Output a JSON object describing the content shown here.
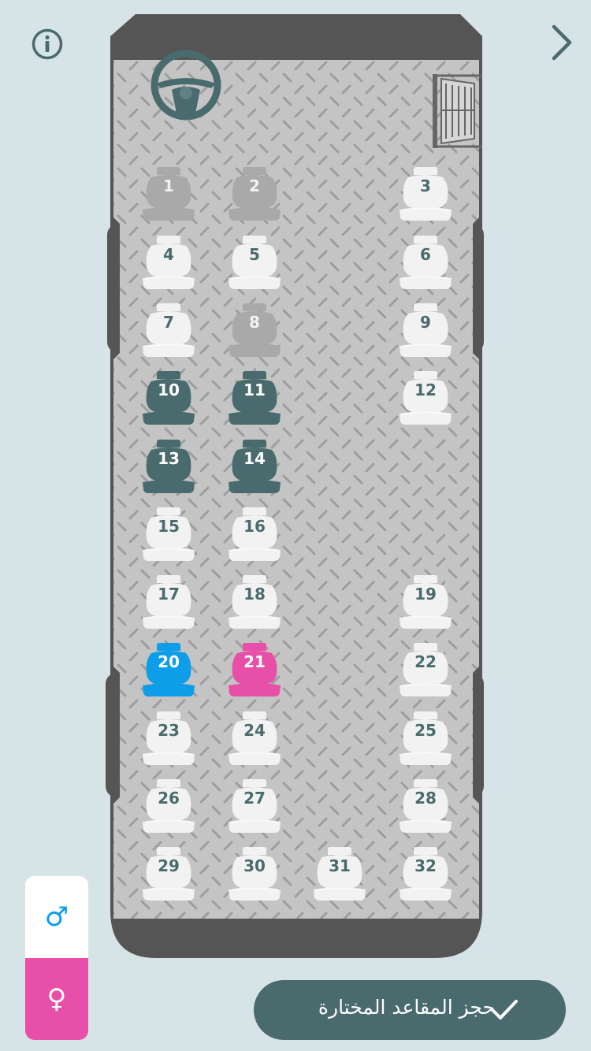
{
  "header": {
    "info_icon": "info-icon",
    "next_icon": "chevron-right-icon"
  },
  "bus": {
    "driver_icon": "steering-wheel-icon",
    "door_icon": "door-stairs-icon",
    "colors": {
      "available": "#f2f2f2",
      "unavailable": "#a9a9a9",
      "booked": "#4a6b6e",
      "male": "#0e9de8",
      "female": "#e84fa8"
    },
    "seats": [
      {
        "label": "1",
        "status": "unavailable"
      },
      {
        "label": "2",
        "status": "unavailable"
      },
      {
        "label": "3",
        "status": "available"
      },
      {
        "label": "4",
        "status": "available"
      },
      {
        "label": "5",
        "status": "available"
      },
      {
        "label": "6",
        "status": "available"
      },
      {
        "label": "7",
        "status": "available"
      },
      {
        "label": "8",
        "status": "unavailable"
      },
      {
        "label": "9",
        "status": "available"
      },
      {
        "label": "10",
        "status": "booked"
      },
      {
        "label": "11",
        "status": "booked"
      },
      {
        "label": "12",
        "status": "available"
      },
      {
        "label": "13",
        "status": "booked"
      },
      {
        "label": "14",
        "status": "booked"
      },
      {
        "label": "15",
        "status": "available"
      },
      {
        "label": "16",
        "status": "available"
      },
      {
        "label": "17",
        "status": "available"
      },
      {
        "label": "18",
        "status": "available"
      },
      {
        "label": "19",
        "status": "available"
      },
      {
        "label": "20",
        "status": "male"
      },
      {
        "label": "21",
        "status": "female"
      },
      {
        "label": "22",
        "status": "available"
      },
      {
        "label": "23",
        "status": "available"
      },
      {
        "label": "24",
        "status": "available"
      },
      {
        "label": "25",
        "status": "available"
      },
      {
        "label": "26",
        "status": "available"
      },
      {
        "label": "27",
        "status": "available"
      },
      {
        "label": "28",
        "status": "available"
      },
      {
        "label": "29",
        "status": "available"
      },
      {
        "label": "30",
        "status": "available"
      },
      {
        "label": "31",
        "status": "available"
      },
      {
        "label": "32",
        "status": "available"
      }
    ]
  },
  "gender": {
    "male_symbol": "♂",
    "female_symbol": "♀",
    "male_color": "#0e9de8",
    "female_color": "#e84fa8"
  },
  "footer": {
    "book_label": "حجز المقاعد المختارة",
    "check_icon": "check-icon"
  }
}
